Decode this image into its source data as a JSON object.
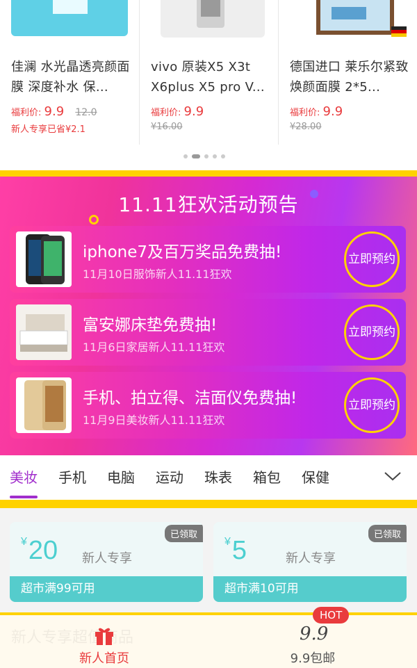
{
  "products": [
    {
      "title": "佳澜 水光晶透亮颜面膜 深度补水 保...",
      "price_label": "福利价:",
      "price": "9.9",
      "old_price": "12.0",
      "saved": "新人专享已省¥2.1"
    },
    {
      "title": "vivo 原装X5 X3t X6plus X5 pro V...",
      "price_label": "福利价:",
      "price": "9.9",
      "old_price": "¥16.00"
    },
    {
      "title": "德国进口 莱乐尔紧致焕颜面膜 2*5...",
      "price_label": "福利价:",
      "price": "9.9",
      "old_price": "¥28.00"
    }
  ],
  "carousel": {
    "count": 5,
    "active": 1
  },
  "promo": {
    "title": "11.11狂欢活动预告",
    "items": [
      {
        "title": "iphone7及百万奖品免费抽!",
        "subtitle": "11月10日服饰新人11.11狂欢",
        "button": "立即预约"
      },
      {
        "title": "富安娜床垫免费抽!",
        "subtitle": "11月6日家居新人11.11狂欢",
        "button": "立即预约"
      },
      {
        "title": "手机、拍立得、洁面仪免费抽!",
        "subtitle": "11月9日美妆新人11.11狂欢",
        "button": "立即预约"
      }
    ]
  },
  "tabs": [
    "美妆",
    "手机",
    "电脑",
    "运动",
    "珠表",
    "箱包",
    "保健"
  ],
  "active_tab": "美妆",
  "coupons": [
    {
      "currency": "¥",
      "amount": "20",
      "tag": "新人专享",
      "badge": "已领取",
      "condition": "超市满99可用"
    },
    {
      "currency": "¥",
      "amount": "5",
      "tag": "新人专享",
      "badge": "已领取",
      "condition": "超市满10可用"
    }
  ],
  "bottom_nav": {
    "ghost_text": "新人专享超值商品",
    "home_label": "新人首页",
    "nine_label": "9.9包邮",
    "nine_icon_text": "9.9",
    "hot_badge": "HOT"
  },
  "colors": {
    "accent": "#e93b3d",
    "purple": "#a12ecc",
    "yellow": "#ffd200",
    "teal": "#55cccc"
  }
}
